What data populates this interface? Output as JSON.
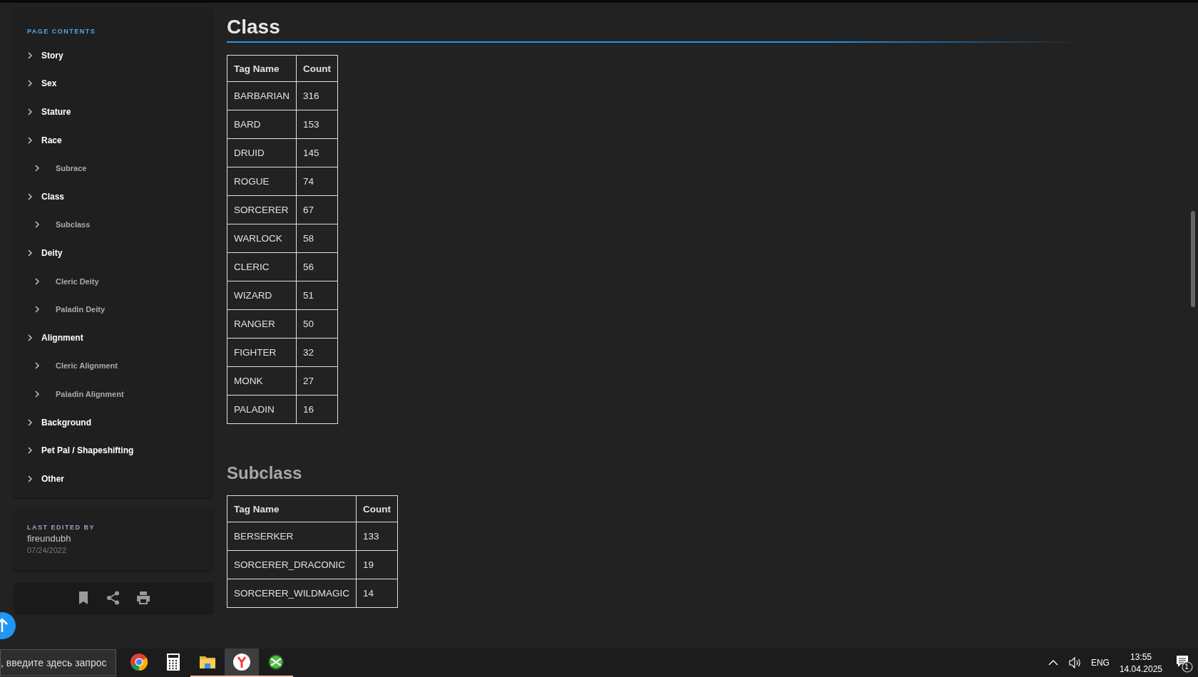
{
  "sidebar": {
    "title": "PAGE CONTENTS",
    "items": [
      {
        "label": "Story"
      },
      {
        "label": "Sex"
      },
      {
        "label": "Stature"
      },
      {
        "label": "Race",
        "children": [
          {
            "label": "Subrace"
          }
        ]
      },
      {
        "label": "Class",
        "children": [
          {
            "label": "Subclass"
          }
        ]
      },
      {
        "label": "Deity",
        "children": [
          {
            "label": "Cleric Deity"
          },
          {
            "label": "Paladin Deity"
          }
        ]
      },
      {
        "label": "Alignment",
        "children": [
          {
            "label": "Cleric Alignment"
          },
          {
            "label": "Paladin Alignment"
          }
        ]
      },
      {
        "label": "Background"
      },
      {
        "label": "Pet Pal / Shapeshifting"
      },
      {
        "label": "Other"
      }
    ]
  },
  "last_edited": {
    "label": "LAST EDITED BY",
    "user": "fireundubh",
    "date": "07/24/2022"
  },
  "sections": [
    {
      "title": "Class",
      "underline": true,
      "columns": [
        "Tag Name",
        "Count"
      ],
      "rows": [
        [
          "BARBARIAN",
          "316"
        ],
        [
          "BARD",
          "153"
        ],
        [
          "DRUID",
          "145"
        ],
        [
          "ROGUE",
          "74"
        ],
        [
          "SORCERER",
          "67"
        ],
        [
          "WARLOCK",
          "58"
        ],
        [
          "CLERIC",
          "56"
        ],
        [
          "WIZARD",
          "51"
        ],
        [
          "RANGER",
          "50"
        ],
        [
          "FIGHTER",
          "32"
        ],
        [
          "MONK",
          "27"
        ],
        [
          "PALADIN",
          "16"
        ]
      ]
    },
    {
      "title": "Subclass",
      "underline": false,
      "columns": [
        "Tag Name",
        "Count"
      ],
      "rows": [
        [
          "BERSERKER",
          "133"
        ],
        [
          "SORCERER_DRACONIC",
          "19"
        ],
        [
          "SORCERER_WILDMAGIC",
          "14"
        ]
      ]
    }
  ],
  "taskbar": {
    "search_placeholder": ", введите здесь запрос",
    "apps": [
      {
        "kind": "chrome",
        "running": false,
        "selected": false
      },
      {
        "kind": "calculator",
        "running": false,
        "selected": false
      },
      {
        "kind": "folder",
        "running": true,
        "selected": false
      },
      {
        "kind": "yandex",
        "running": true,
        "selected": true
      },
      {
        "kind": "xbox",
        "running": true,
        "selected": false
      }
    ],
    "language": "ENG",
    "time": "13:55",
    "date": "14.04.2025",
    "notifications": "1"
  }
}
